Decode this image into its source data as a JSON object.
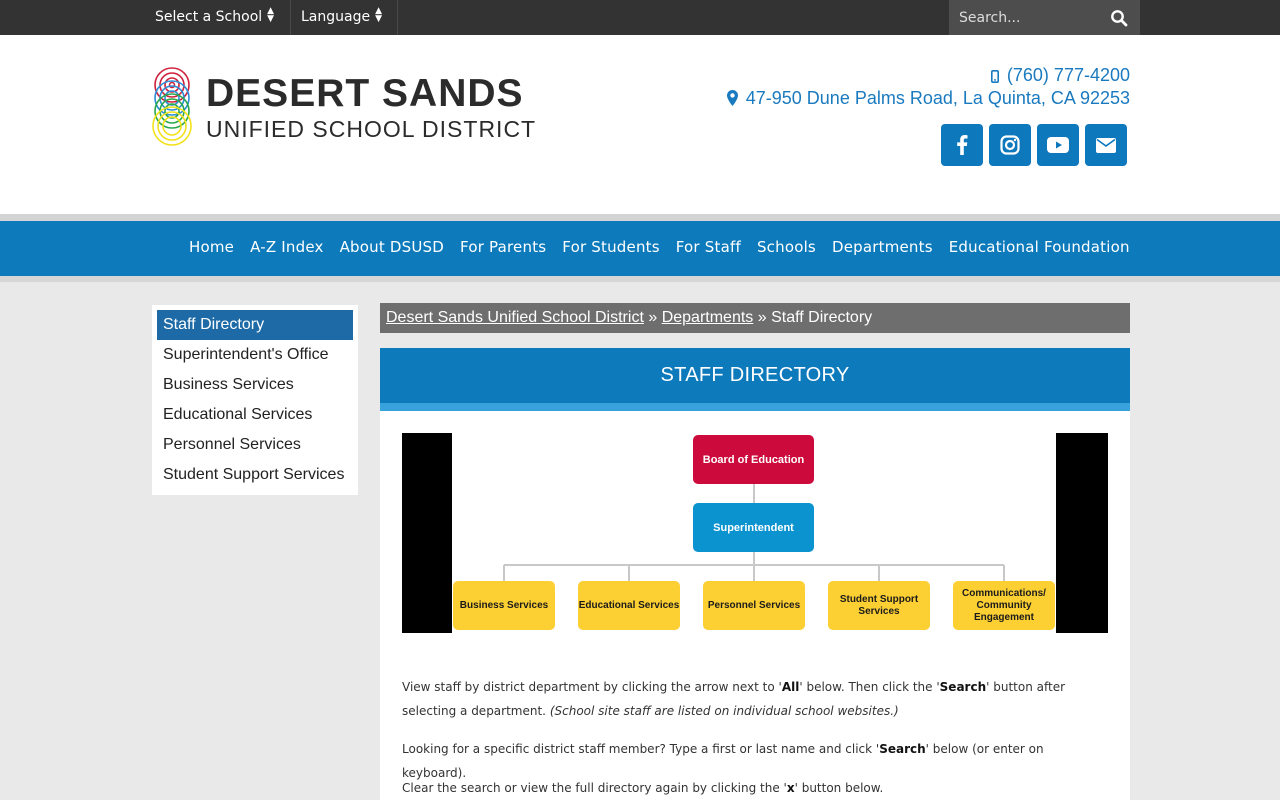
{
  "topbar": {
    "school_select": "Select a School",
    "language_select": "Language",
    "search_placeholder": "Search..."
  },
  "header": {
    "logo_title": "DESERT SANDS",
    "logo_subtitle": "UNIFIED SCHOOL DISTRICT",
    "phone": "(760) 777-4200",
    "address": "47-950 Dune Palms Road, La Quinta, CA 92253",
    "social": [
      "facebook-icon",
      "instagram-icon",
      "youtube-icon",
      "envelope-icon"
    ]
  },
  "nav": {
    "items": [
      "Home",
      "A-Z Index",
      "About DSUSD",
      "For Parents",
      "For Students",
      "For Staff",
      "Schools",
      "Departments",
      "Educational Foundation"
    ]
  },
  "sidebar": {
    "items": [
      "Staff Directory",
      "Superintendent's Office",
      "Business Services",
      "Educational Services",
      "Personnel Services",
      "Student Support Services"
    ]
  },
  "breadcrumb": {
    "home": "Desert Sands Unified School District",
    "sep1": " » ",
    "section": "Departments",
    "sep2": " » ",
    "current": "Staff Directory"
  },
  "content": {
    "title": "STAFF DIRECTORY",
    "org_chart": {
      "board": "Board of Education",
      "superintendent": "Superintendent",
      "departments": [
        "Business Services",
        "Educational Services",
        "Personnel Services",
        "Student Support Services",
        "Communications/ Community Engagement"
      ]
    },
    "para1": {
      "a": "View staff by district department by clicking the arrow next to '",
      "b": "All",
      "c": "' below. Then click the '",
      "d": "Search",
      "e": "' button after selecting a department. ",
      "f": "(School site staff are listed on individual school websites.)"
    },
    "para2": {
      "a": "Looking for a specific district staff member? Type a first or last name and click '",
      "b": "Search",
      "c": "' below (or enter on keyboard)."
    },
    "para3": {
      "a": "Clear the search or view the full directory again by clicking the '",
      "b": "x",
      "c": "' button below."
    }
  },
  "colors": {
    "primary_blue": "#0d7abc",
    "topbar": "#333333",
    "board_red": "#cc0a3c",
    "superintendent_blue": "#0b93d0",
    "department_yellow": "#fccf33"
  }
}
